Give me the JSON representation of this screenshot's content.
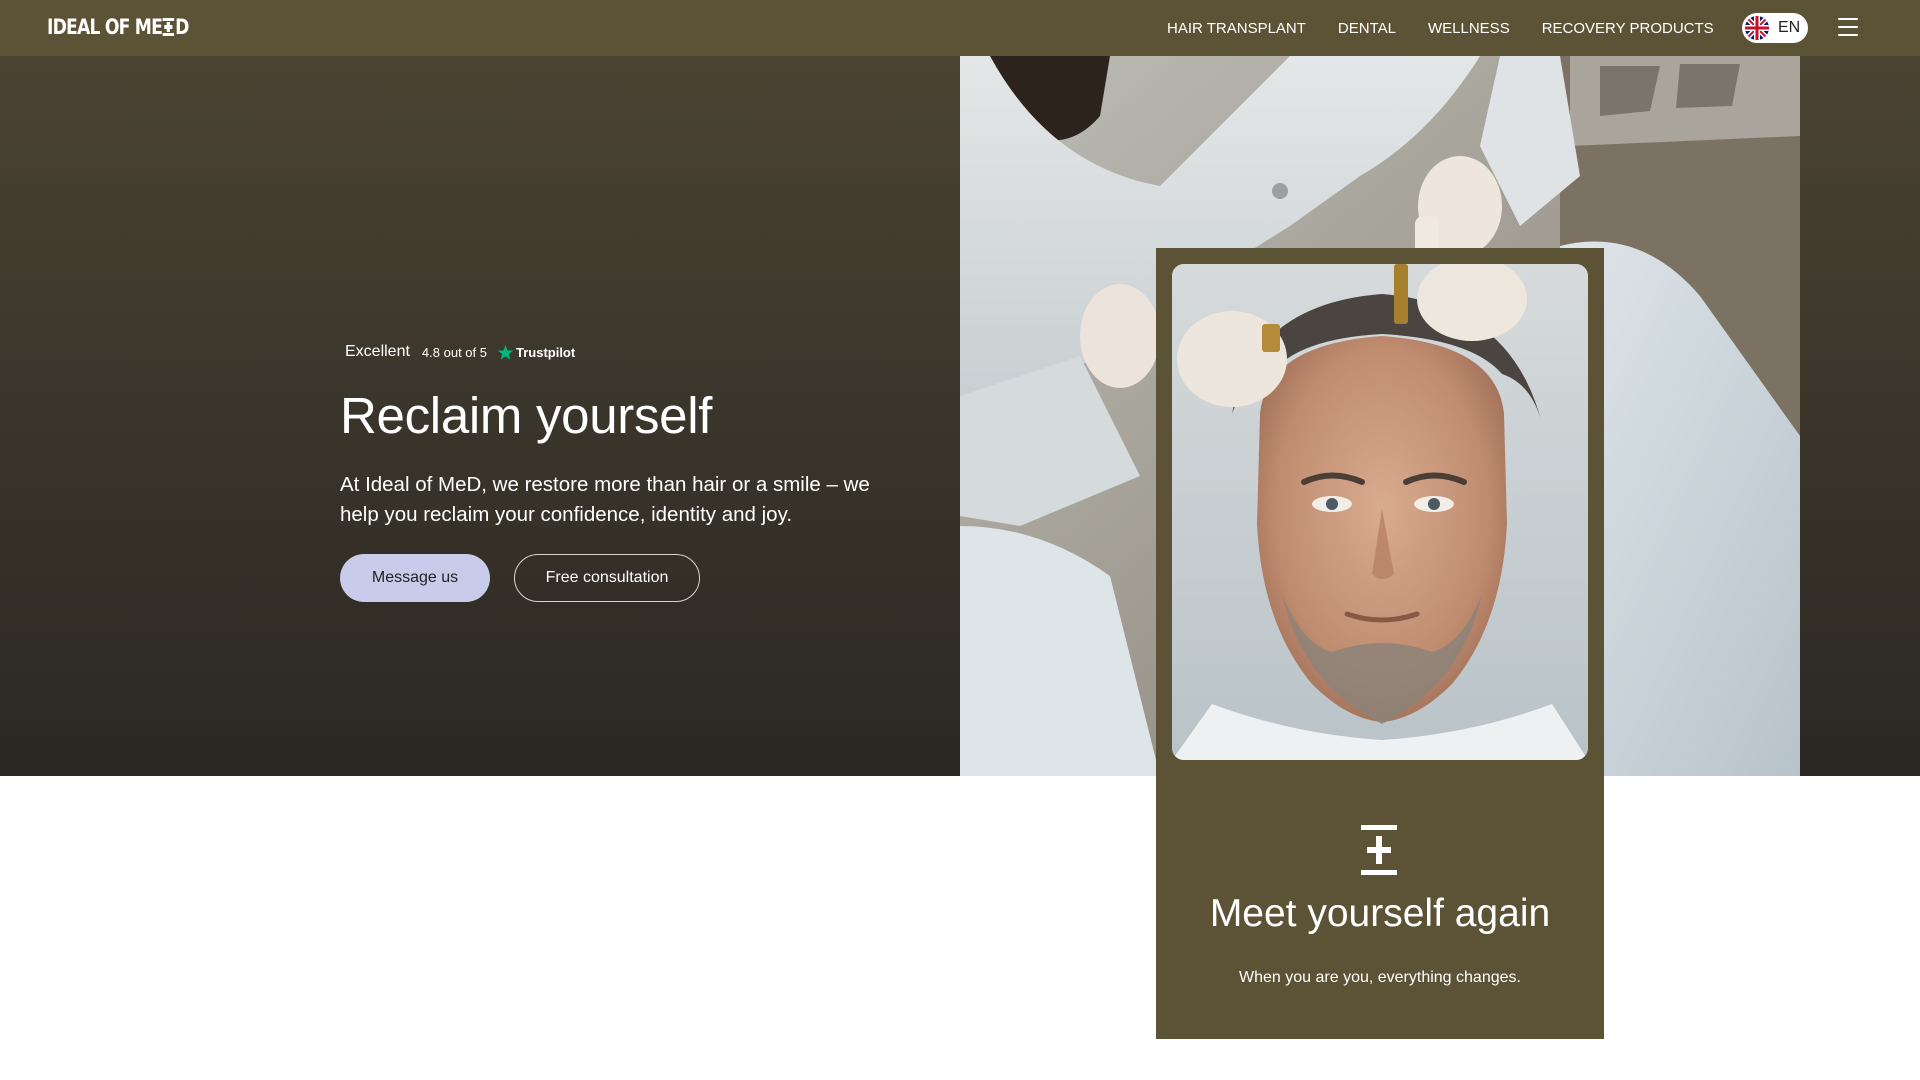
{
  "header": {
    "logo_left": "IDEAL OF ME",
    "logo_right": "D",
    "nav": [
      "HAIR TRANSPLANT",
      "DENTAL",
      "WELLNESS",
      "RECOVERY PRODUCTS"
    ],
    "language": "EN"
  },
  "hero": {
    "rating_word": "Excellent",
    "rating_score": "4.8 out of 5",
    "rating_source": "Trustpilot",
    "title": "Reclaim yourself",
    "subtitle": "At Ideal of MeD, we restore more than hair or a smile – we help you reclaim your confidence, identity and joy.",
    "primary_button": "Message us",
    "secondary_button": "Free consultation"
  },
  "card": {
    "title": "Meet yourself again",
    "subtitle": "When you are you, everything changes."
  },
  "colors": {
    "brand": "#5c5337",
    "button": "#c8ccea",
    "trustpilot_green": "#00b67a"
  }
}
